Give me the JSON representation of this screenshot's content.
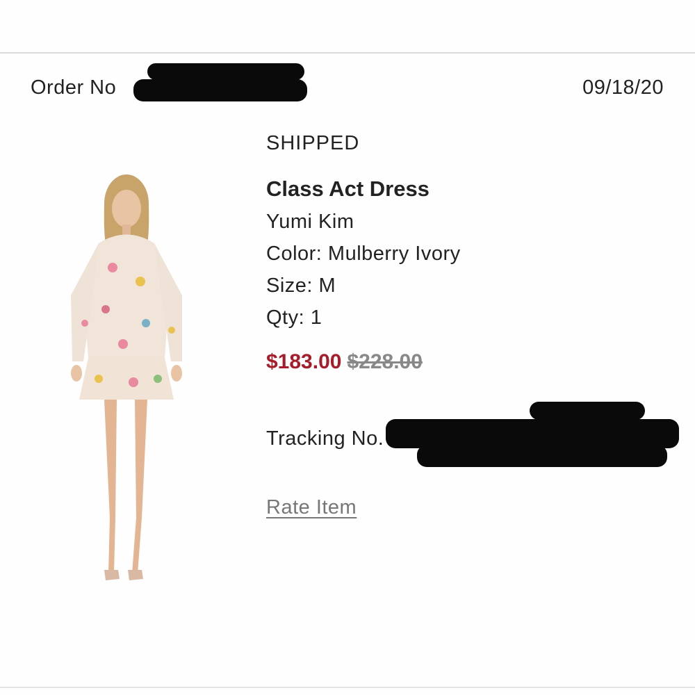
{
  "order": {
    "label": "Order No",
    "date": "09/18/20"
  },
  "item": {
    "status": "SHIPPED",
    "name": "Class Act Dress",
    "brand": "Yumi Kim",
    "color": "Color: Mulberry Ivory",
    "size": "Size: M",
    "qty": "Qty: 1",
    "price_sale": "$183.00",
    "price_original": "$228.00",
    "tracking_label": "Tracking No.",
    "rate_link": "Rate Item"
  },
  "colors": {
    "sale_price": "#a51c2a",
    "original_price": "#888888",
    "link": "#777777",
    "divider": "#d9d9d9"
  }
}
